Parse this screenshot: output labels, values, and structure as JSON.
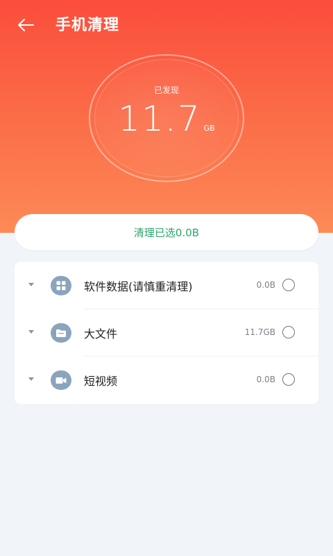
{
  "header": {
    "title": "手机清理",
    "found_label": "已发现",
    "total_size": "11.7",
    "total_unit": "GB"
  },
  "clean_button": {
    "label": "清理已选0.0B"
  },
  "categories": [
    {
      "name": "软件数据(请慎重清理)",
      "size": "0.0B",
      "icon": "apps-grid-icon",
      "selected": false
    },
    {
      "name": "大文件",
      "size": "11.7GB",
      "icon": "folder-icon",
      "selected": false
    },
    {
      "name": "短视频",
      "size": "0.0B",
      "icon": "video-camera-icon",
      "selected": false
    }
  ],
  "colors": {
    "header_top": "#fb4d3b",
    "header_bottom": "#fd8a57",
    "accent_green": "#2aa66b",
    "icon_badge": "#8aa4bd",
    "background": "#f1f4f8"
  }
}
